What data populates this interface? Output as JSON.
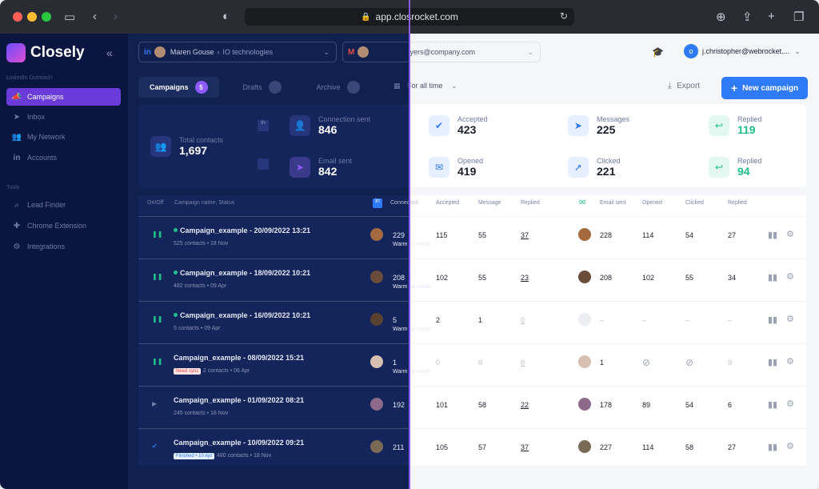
{
  "browser": {
    "url": "app.closrocket.com"
  },
  "sidebar": {
    "brand": "Closely",
    "section1": "LinkedIn Outreach",
    "section2": "Tools",
    "items": [
      {
        "label": "Campaigns",
        "icon": "megaphone-icon"
      },
      {
        "label": "Inbox",
        "icon": "send-icon"
      },
      {
        "label": "My Network",
        "icon": "people-icon"
      },
      {
        "label": "Accounts",
        "icon": "linkedin-icon"
      },
      {
        "label": "Lead Finder",
        "icon": "search-icon"
      },
      {
        "label": "Chrome Extension",
        "icon": "puzzle-icon"
      },
      {
        "label": "Integrations",
        "icon": "integrations-icon"
      }
    ]
  },
  "header": {
    "linkedin_account": "Maren Gouse",
    "linkedin_company": "IO technologies",
    "email_account": "naomi.myers@company.com",
    "user": "j.christopher@webrocket....",
    "user_initial": "o"
  },
  "tabs": [
    {
      "label": "Campaigns",
      "count": "5"
    },
    {
      "label": "Drafts",
      "count": ""
    },
    {
      "label": "Archive",
      "count": ""
    }
  ],
  "period": "For all time",
  "export_label": "Export",
  "new_campaign_label": "New campaign",
  "stats": {
    "total_contacts": {
      "label": "Total contacts",
      "value": "1,697"
    },
    "connection_sent": {
      "label": "Connection sent",
      "value": "846"
    },
    "email_sent": {
      "label": "Email sent",
      "value": "842"
    },
    "accepted": {
      "label": "Accepted",
      "value": "423"
    },
    "messages": {
      "label": "Messages",
      "value": "225"
    },
    "replied_li": {
      "label": "Replied",
      "value": "119"
    },
    "opened": {
      "label": "Opened",
      "value": "419"
    },
    "clicked": {
      "label": "Clicked",
      "value": "221"
    },
    "replied_em": {
      "label": "Replied",
      "value": "94"
    }
  },
  "table": {
    "headers": {
      "onoff": "On/Off",
      "name": "Campaign name, Status",
      "connection": "Connection",
      "accepted": "Accepted",
      "message": "Message",
      "replied": "Replied",
      "email_sent": "Email sent",
      "opened": "Opened",
      "clicked": "Clicked",
      "replied2": "Replied"
    },
    "rows": [
      {
        "name": "Campaign_example - 20/09/2022 13:21",
        "meta": "525 contacts  •  18 Nov",
        "badge": "",
        "conn": "229",
        "acc": "115",
        "msg": "55",
        "rep": "37",
        "warm": "Warm up mode",
        "es": "228",
        "op": "114",
        "cl": "54",
        "rep2": "27"
      },
      {
        "name": "Campaign_example - 18/09/2022 10:21",
        "meta": "482 contacts  •  09 Apr",
        "badge": "",
        "conn": "208",
        "acc": "102",
        "msg": "55",
        "rep": "23",
        "warm": "Warm up mode",
        "es": "208",
        "op": "102",
        "cl": "55",
        "rep2": "34"
      },
      {
        "name": "Campaign_example - 16/09/2022 10:21",
        "meta": "5 contacts  •  09 Apr",
        "badge": "",
        "conn": "5",
        "acc": "2",
        "msg": "1",
        "rep": "0",
        "warm": "Warm up mode",
        "es": "–",
        "op": "–",
        "cl": "–",
        "rep2": "–"
      },
      {
        "name": "Campaign_example - 08/09/2022 15:21",
        "meta": "2 contacts  •  06 Apr",
        "badge": "Need sync",
        "conn": "1",
        "acc": "0",
        "msg": "0",
        "rep": "0",
        "warm": "Warm up mode",
        "es": "1",
        "op": "",
        "cl": "",
        "rep2": "0"
      },
      {
        "name": "Campaign_example - 01/09/2022 08:21",
        "meta": "245 contacts  •  18 Nov",
        "badge": "",
        "conn": "192",
        "acc": "101",
        "msg": "58",
        "rep": "22",
        "warm": "",
        "es": "178",
        "op": "89",
        "cl": "54",
        "rep2": "6"
      },
      {
        "name": "Campaign_example - 10/09/2022 09:21",
        "meta": "480 contacts  •  18 Nov",
        "badge": "Finished • 10 Apr",
        "conn": "211",
        "acc": "105",
        "msg": "57",
        "rep": "37",
        "warm": "",
        "es": "227",
        "op": "114",
        "cl": "58",
        "rep2": "27"
      }
    ]
  },
  "colors": {
    "accent": "#8d5bff",
    "primary": "#2f7af7",
    "green": "#1fbf8a",
    "sidebar": "#0b1640"
  }
}
